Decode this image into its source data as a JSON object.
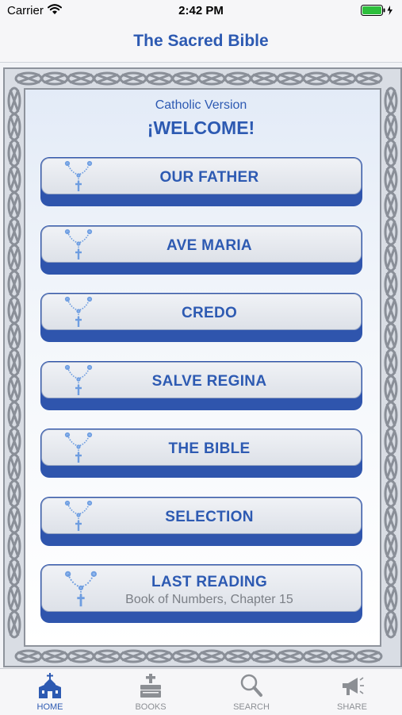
{
  "status": {
    "carrier": "Carrier",
    "time": "2:42 PM"
  },
  "nav": {
    "title": "The Sacred Bible"
  },
  "header": {
    "subtitle": "Catholic Version",
    "welcome": "¡WELCOME!"
  },
  "menu": [
    {
      "label": "OUR FATHER"
    },
    {
      "label": "AVE MARIA"
    },
    {
      "label": "CREDO"
    },
    {
      "label": "SALVE REGINA"
    },
    {
      "label": "THE BIBLE"
    },
    {
      "label": "SELECTION"
    },
    {
      "label": "LAST READING",
      "sublabel": "Book of Numbers, Chapter 15"
    }
  ],
  "tabs": [
    {
      "label": "HOME",
      "icon": "church-icon",
      "active": true
    },
    {
      "label": "BOOKS",
      "icon": "books-icon",
      "active": false
    },
    {
      "label": "SEARCH",
      "icon": "search-icon",
      "active": false
    },
    {
      "label": "SHARE",
      "icon": "megaphone-icon",
      "active": false
    }
  ],
  "colors": {
    "accent": "#2d5ab2",
    "button_base": "#2f55ad",
    "inactive": "#8c8f94"
  }
}
